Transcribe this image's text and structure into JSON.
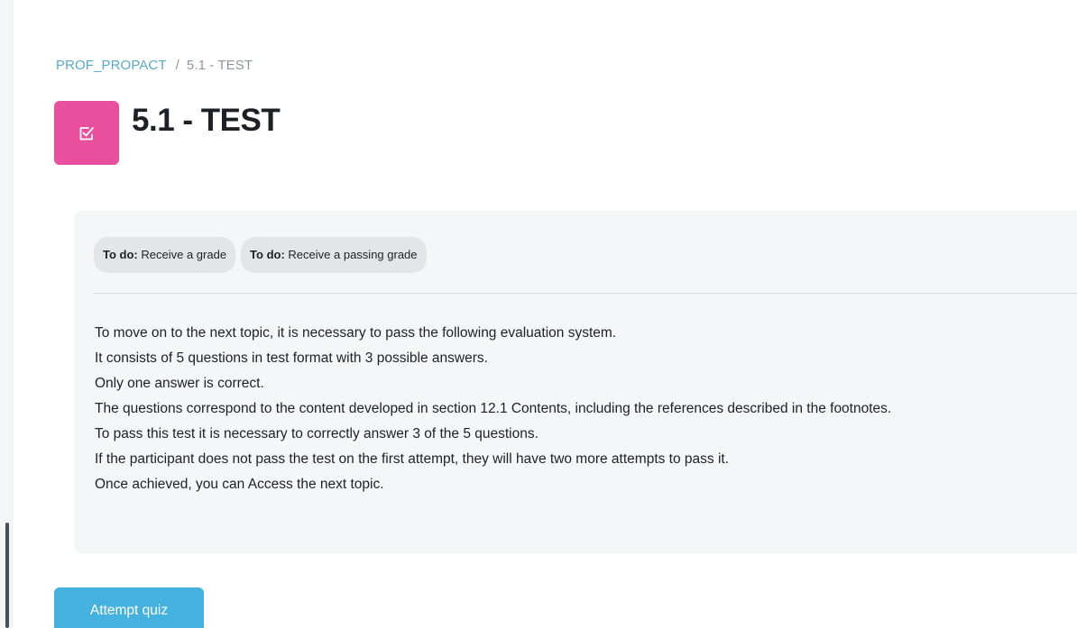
{
  "breadcrumb": {
    "course": "PROF_PROPACT",
    "separator": "/",
    "current": "5.1 - TEST"
  },
  "header": {
    "icon": "quiz-checkbox-icon",
    "icon_color": "#e8509d",
    "title": "5.1 - TEST"
  },
  "completion": {
    "badges": [
      {
        "prefix": "To do:",
        "text": "Receive a grade"
      },
      {
        "prefix": "To do:",
        "text": "Receive a passing grade"
      }
    ]
  },
  "description": {
    "lines": [
      "To move on to the next topic, it is necessary to pass the following evaluation system.",
      "It consists of 5 questions in test format with 3 possible answers.",
      "Only one answer is correct.",
      "The questions correspond to the content developed in section 12.1 Contents, including the references described in the footnotes.",
      "To pass this test it is necessary to correctly answer 3 of the 5 questions.",
      "If the participant does not pass the test on the first attempt, they will have two more attempts to pass it.",
      "Once achieved, you can Access the next topic."
    ]
  },
  "actions": {
    "attempt_label": "Attempt quiz",
    "attempt_color": "#45b1de"
  },
  "colors": {
    "link": "#5aa9c8",
    "box_background": "#f5f6f7"
  }
}
